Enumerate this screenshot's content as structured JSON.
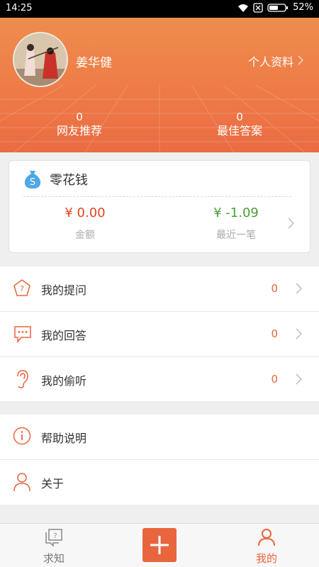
{
  "status_bar": {
    "time": "14:25",
    "battery": "52%"
  },
  "profile": {
    "username": "姜华健",
    "profile_link": "个人资料",
    "stats": [
      {
        "value": "0",
        "label": "网友推荐"
      },
      {
        "value": "0",
        "label": "最佳答案"
      }
    ]
  },
  "wallet": {
    "title": "零花钱",
    "balance": {
      "value": "¥ 0.00",
      "label": "金额"
    },
    "recent": {
      "value": "¥ -1.09",
      "label": "最近一笔"
    }
  },
  "menu_main": [
    {
      "label": "我的提问",
      "count": "0",
      "icon": "question-pentagon-icon"
    },
    {
      "label": "我的回答",
      "count": "0",
      "icon": "chat-bubble-icon"
    },
    {
      "label": "我的偷听",
      "count": "0",
      "icon": "ear-icon"
    }
  ],
  "menu_other": [
    {
      "label": "帮助说明",
      "icon": "info-icon"
    },
    {
      "label": "关于",
      "icon": "person-icon"
    }
  ],
  "tabs": [
    {
      "label": "求知",
      "icon": "question-cards-icon"
    },
    {
      "label": "我的",
      "icon": "person-icon"
    }
  ],
  "colors": {
    "accent": "#e8653e",
    "positive": "#49a033",
    "negative": "#e0451f"
  }
}
